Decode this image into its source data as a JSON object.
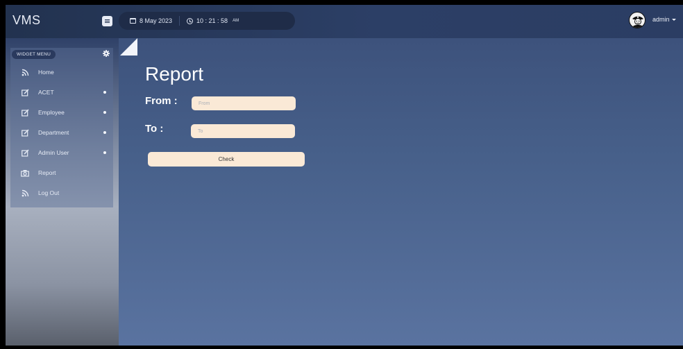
{
  "app": {
    "brand": "VMS"
  },
  "header": {
    "date": "8 May 2023",
    "time": "10 : 21 : 58",
    "ampm": "AM",
    "user": "admin"
  },
  "sidebar": {
    "widget_label": "WIDGET MENU",
    "items": [
      {
        "label": "Home",
        "icon": "rss-icon",
        "dot": false
      },
      {
        "label": "ACET",
        "icon": "edit-icon",
        "dot": true
      },
      {
        "label": "Employee",
        "icon": "edit-icon",
        "dot": true
      },
      {
        "label": "Department",
        "icon": "edit-icon",
        "dot": true
      },
      {
        "label": "Admin User",
        "icon": "edit-icon",
        "dot": true
      },
      {
        "label": "Report",
        "icon": "camera-icon",
        "dot": false
      },
      {
        "label": "Log Out",
        "icon": "rss-icon",
        "dot": false
      }
    ]
  },
  "main": {
    "title": "Report",
    "from_label": "From :",
    "from_placeholder": "From",
    "to_label": "To :",
    "to_placeholder": "To",
    "check_label": "Check"
  },
  "colors": {
    "topbar": "#22324f",
    "content": "#47608a",
    "input_bg": "#fae9d6"
  }
}
